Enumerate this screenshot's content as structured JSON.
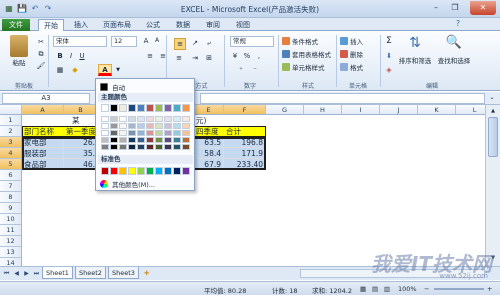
{
  "window": {
    "title": "EXCEL - Microsoft Excel(产品激活失败)",
    "min": "–",
    "max": "❐",
    "close": "✕"
  },
  "tabs": [
    {
      "label": "文件"
    },
    {
      "label": "开始"
    },
    {
      "label": "插入"
    },
    {
      "label": "页面布局"
    },
    {
      "label": "公式"
    },
    {
      "label": "数据"
    },
    {
      "label": "审阅"
    },
    {
      "label": "视图"
    }
  ],
  "ribbon": {
    "clipboard": {
      "paste": "粘贴",
      "label": "剪贴板"
    },
    "font": {
      "name": "宋体",
      "size": "12",
      "label": "字体"
    },
    "alignment": {
      "label": "对齐方式"
    },
    "number": {
      "format": "常规",
      "label": "数字"
    },
    "styles": {
      "conditional": "条件格式",
      "table": "套用表格格式",
      "cell": "单元格样式",
      "label": "样式"
    },
    "cells": {
      "insert": "插入",
      "delete": "删除",
      "format": "格式",
      "label": "单元格"
    },
    "editing": {
      "sort": "排序和筛选",
      "find": "查找和选择",
      "label": "编辑"
    }
  },
  "formula_bar": {
    "namebox": "A3"
  },
  "color_panel": {
    "auto": "自动",
    "theme_title": "主题颜色",
    "standard_title": "标准色",
    "more": "其他颜色(M)...",
    "theme_top": [
      "#ffffff",
      "#000000",
      "#eeece1",
      "#1f497d",
      "#4f81bd",
      "#c0504d",
      "#9bbb59",
      "#8064a2",
      "#4bacc6",
      "#f79646"
    ],
    "standard": [
      "#c00000",
      "#ff0000",
      "#ffc000",
      "#ffff00",
      "#92d050",
      "#00b050",
      "#00b0f0",
      "#0070c0",
      "#002060",
      "#7030a0"
    ]
  },
  "grid": {
    "columns": [
      "A",
      "B",
      "C",
      "D",
      "E",
      "F",
      "G",
      "H",
      "I",
      "J",
      "K",
      "L"
    ],
    "rows": [
      "1",
      "2",
      "3",
      "4",
      "5",
      "6",
      "7",
      "8",
      "9",
      "10",
      "11",
      "12",
      "13",
      "14"
    ],
    "r1_text": "某",
    "r1_right": "元)",
    "header": {
      "a": "部门名称",
      "b": "第一季度",
      "e": "四季度",
      "f": "合计"
    },
    "data": [
      {
        "a": "家电部",
        "b": "26.",
        "e": "63.5",
        "f": "196.8"
      },
      {
        "a": "服装部",
        "b": "35.",
        "e": "58.4",
        "f": "171.9"
      },
      {
        "a": "食品部",
        "b": "46.",
        "e": "67.9",
        "f": "233.40"
      }
    ]
  },
  "sheets": [
    {
      "label": "Sheet1"
    },
    {
      "label": "Sheet2"
    },
    {
      "label": "Sheet3"
    }
  ],
  "status": {
    "average": "平均值: 80.28",
    "count": "计数: 18",
    "sum": "求和: 1204.2",
    "zoom": "100%"
  },
  "watermark": {
    "big": "我爱IT技术网",
    "small": "www.52ij.com"
  }
}
